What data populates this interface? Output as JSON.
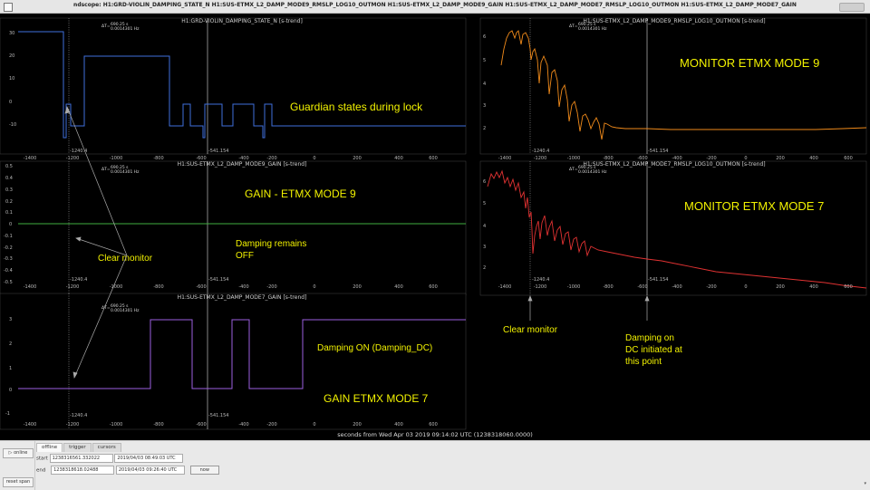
{
  "window": {
    "title": "ndscope: H1:GRD-VIOLIN_DAMPING_STATE_N H1:SUS-ETMX_L2_DAMP_MODE9_RMSLP_LOG10_OUTMON H1:SUS-ETMX_L2_DAMP_MODE9_GAIN H1:SUS-ETMX_L2_DAMP_MODE7_RMSLP_LOG10_OUTMON H1:SUS-ETMX_L2_DAMP_MODE7_GAIN"
  },
  "cursor": {
    "dt_label": "ΔT=",
    "dt_value": "690.25 s",
    "df_value": "0.0014301 Hz",
    "c1_label": "-1240.4",
    "c2_label": "-541.154"
  },
  "x_ticks": [
    "-1400",
    "-1200",
    "-1000",
    "-800",
    "-600",
    "-400",
    "-200",
    "0",
    "200",
    "400",
    "600"
  ],
  "x_axis_label": "seconds from Wed Apr 03 2019 09:14:02 UTC (1238318060.0000)",
  "plots": {
    "p1": {
      "title": "H1:GRD-VIOLIN_DAMPING_STATE_N [s-trend]",
      "yticks": [
        "30",
        "20",
        "10",
        "0",
        "-10"
      ]
    },
    "p2": {
      "title": "H1:SUS-ETMX_L2_DAMP_MODE9_GAIN [s-trend]",
      "yticks": [
        "0.5",
        "0.4",
        "0.3",
        "0.2",
        "0.1",
        "0",
        "-0.1",
        "-0.2",
        "-0.3",
        "-0.4",
        "-0.5"
      ]
    },
    "p3": {
      "title": "H1:SUS-ETMX_L2_DAMP_MODE7_GAIN [s-trend]",
      "yticks": [
        "3",
        "2",
        "1",
        "0",
        "-1"
      ]
    },
    "p4": {
      "title": "H1:SUS-ETMX_L2_DAMP_MODE9_RMSLP_LOG10_OUTMON [s-trend]",
      "yticks": [
        "6",
        "5",
        "4",
        "3",
        "2"
      ]
    },
    "p5": {
      "title": "H1:SUS-ETMX_L2_DAMP_MODE7_RMSLP_LOG10_OUTMON [s-trend]",
      "yticks": [
        "6",
        "5",
        "4",
        "3",
        "2"
      ]
    }
  },
  "annotations": {
    "guardian": "Guardian states during lock",
    "gain9": "GAIN - ETMX MODE 9",
    "clear_monitor_left": "Clear monitor",
    "damping_remains_1": "Damping remains",
    "damping_remains_2": "OFF",
    "damping_on": "Damping ON  (Damping_DC)",
    "gain7": "GAIN ETMX MODE 7",
    "monitor9": "MONITOR ETMX MODE 9",
    "monitor7": "MONITOR ETMX MODE 7",
    "clear_monitor_right": "Clear monitor",
    "damping_dc_1": "Damping on",
    "damping_dc_2": "DC initiated at",
    "damping_dc_3": "this point"
  },
  "colors": {
    "p1": "#3f6fdc",
    "p2": "#3fae3f",
    "p3": "#9b5fe0",
    "p4": "#f08a1a",
    "p5": "#e03232",
    "annotation": "#f2f200"
  },
  "controls": {
    "online_label": "▷ online",
    "reset_span_label": "reset span",
    "tabs": [
      "offline",
      "trigger",
      "cursors"
    ],
    "start_label": "start",
    "start_gps": "1238316561.332022",
    "start_utc": "2019/04/03 08:49:03 UTC",
    "end_label": "end",
    "end_gps": "1238318618.02488",
    "end_utc": "2019/04/03 09:26:40 UTC",
    "now_label": "now"
  }
}
